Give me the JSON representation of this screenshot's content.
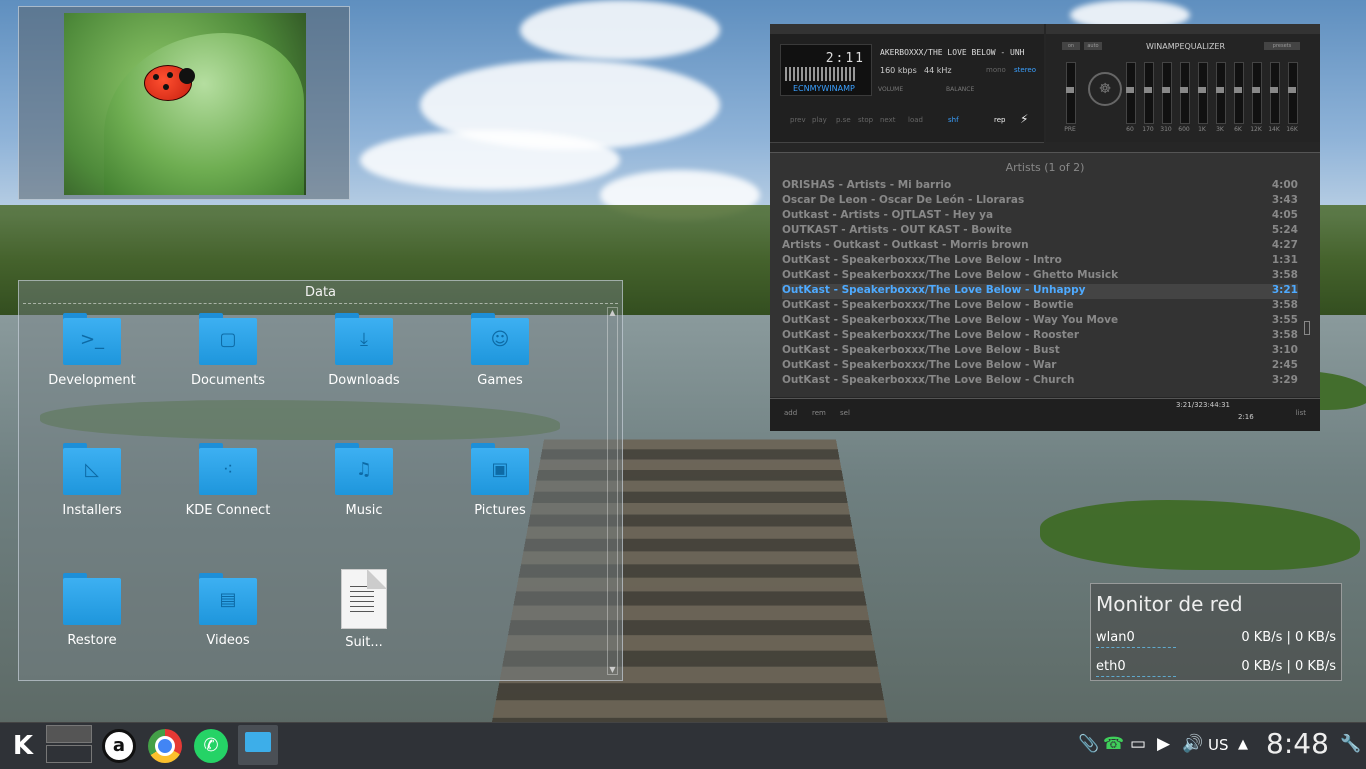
{
  "folder": {
    "title": "Data",
    "items": [
      {
        "label": "Development",
        "glyph": ">_"
      },
      {
        "label": "Documents",
        "glyph": "▢"
      },
      {
        "label": "Downloads",
        "glyph": "⤓"
      },
      {
        "label": "Games",
        "glyph": "☺"
      },
      {
        "label": "Installers",
        "glyph": "◺"
      },
      {
        "label": "KDE Connect",
        "glyph": "⁖"
      },
      {
        "label": "Music",
        "glyph": "♫"
      },
      {
        "label": "Pictures",
        "glyph": "▣"
      },
      {
        "label": "Restore",
        "glyph": ""
      },
      {
        "label": "Videos",
        "glyph": "▤"
      },
      {
        "label": "Suit...",
        "glyph": ""
      }
    ]
  },
  "winamp": {
    "time": "2:11",
    "ticker": "AKERBOXXX/THE LOVE BELOW - UNH",
    "kbps": "160 kbps",
    "khz": "44 kHz",
    "mono": "mono",
    "stereo": "stereo",
    "brand": "ECNMYWINAMP",
    "volume_label": "VOLUME",
    "balance_label": "BALANCE",
    "controls": {
      "prev": "prev",
      "play": "play",
      "pause": "p.se",
      "stop": "stop",
      "next": "next",
      "load": "load",
      "shf": "shf",
      "rep": "rep"
    },
    "eq_title": "WINAMPEQUALIZER",
    "eq_on": "on",
    "eq_auto": "auto",
    "eq_presets": "presets",
    "eq_bands": [
      "PRE",
      "60",
      "170",
      "310",
      "600",
      "1K",
      "3K",
      "6K",
      "12K",
      "14K",
      "16K"
    ],
    "playlist_header": "Artists (1 of 2)",
    "playlist": [
      {
        "title": "ORISHAS - Artists - Mi barrio",
        "time": "4:00"
      },
      {
        "title": "Oscar De Leon - Oscar De León - Lloraras",
        "time": "3:43"
      },
      {
        "title": "Outkast - Artists - OJTLAST - Hey ya",
        "time": "4:05"
      },
      {
        "title": "OUTKAST - Artists - OUT KAST - Bowite",
        "time": "5:24"
      },
      {
        "title": "Artists - Outkast - Outkast - Morris brown",
        "time": "4:27"
      },
      {
        "title": "OutKast - Speakerboxxx/The Love Below - Intro",
        "time": "1:31"
      },
      {
        "title": "OutKast - Speakerboxxx/The Love Below - Ghetto Musick",
        "time": "3:58"
      },
      {
        "title": "OutKast - Speakerboxxx/The Love Below - Unhappy",
        "time": "3:21"
      },
      {
        "title": "OutKast - Speakerboxxx/The Love Below - Bowtie",
        "time": "3:58"
      },
      {
        "title": "OutKast - Speakerboxxx/The Love Below - Way You Move",
        "time": "3:55"
      },
      {
        "title": "OutKast - Speakerboxxx/The Love Below - Rooster",
        "time": "3:58"
      },
      {
        "title": "OutKast - Speakerboxxx/The Love Below - Bust",
        "time": "3:10"
      },
      {
        "title": "OutKast - Speakerboxxx/The Love Below - War",
        "time": "2:45"
      },
      {
        "title": "OutKast - Speakerboxxx/The Love Below - Church",
        "time": "3:29"
      }
    ],
    "playlist_active_index": 7,
    "bottom": {
      "add": "add",
      "rem": "rem",
      "sel": "sel",
      "total": "3:21/323:44:31",
      "elapsed": "2:16",
      "list": "list"
    }
  },
  "netmon": {
    "title": "Monitor de red",
    "rows": [
      {
        "iface": "wlan0",
        "value": "0 KB/s | 0 KB/s"
      },
      {
        "iface": "eth0",
        "value": "0 KB/s | 0 KB/s"
      }
    ]
  },
  "taskbar": {
    "apps": [
      {
        "name": "a",
        "icon": "amarok-icon",
        "color": "#ffffff"
      },
      {
        "name": "",
        "icon": "chrome-icon",
        "color": "#e53935"
      },
      {
        "name": "",
        "icon": "whatsapp-icon",
        "color": "#25d366"
      },
      {
        "name": "",
        "icon": "file-manager-icon",
        "color": "#3daee9"
      }
    ],
    "keyboard_layout": "US",
    "clock": "8:48"
  }
}
